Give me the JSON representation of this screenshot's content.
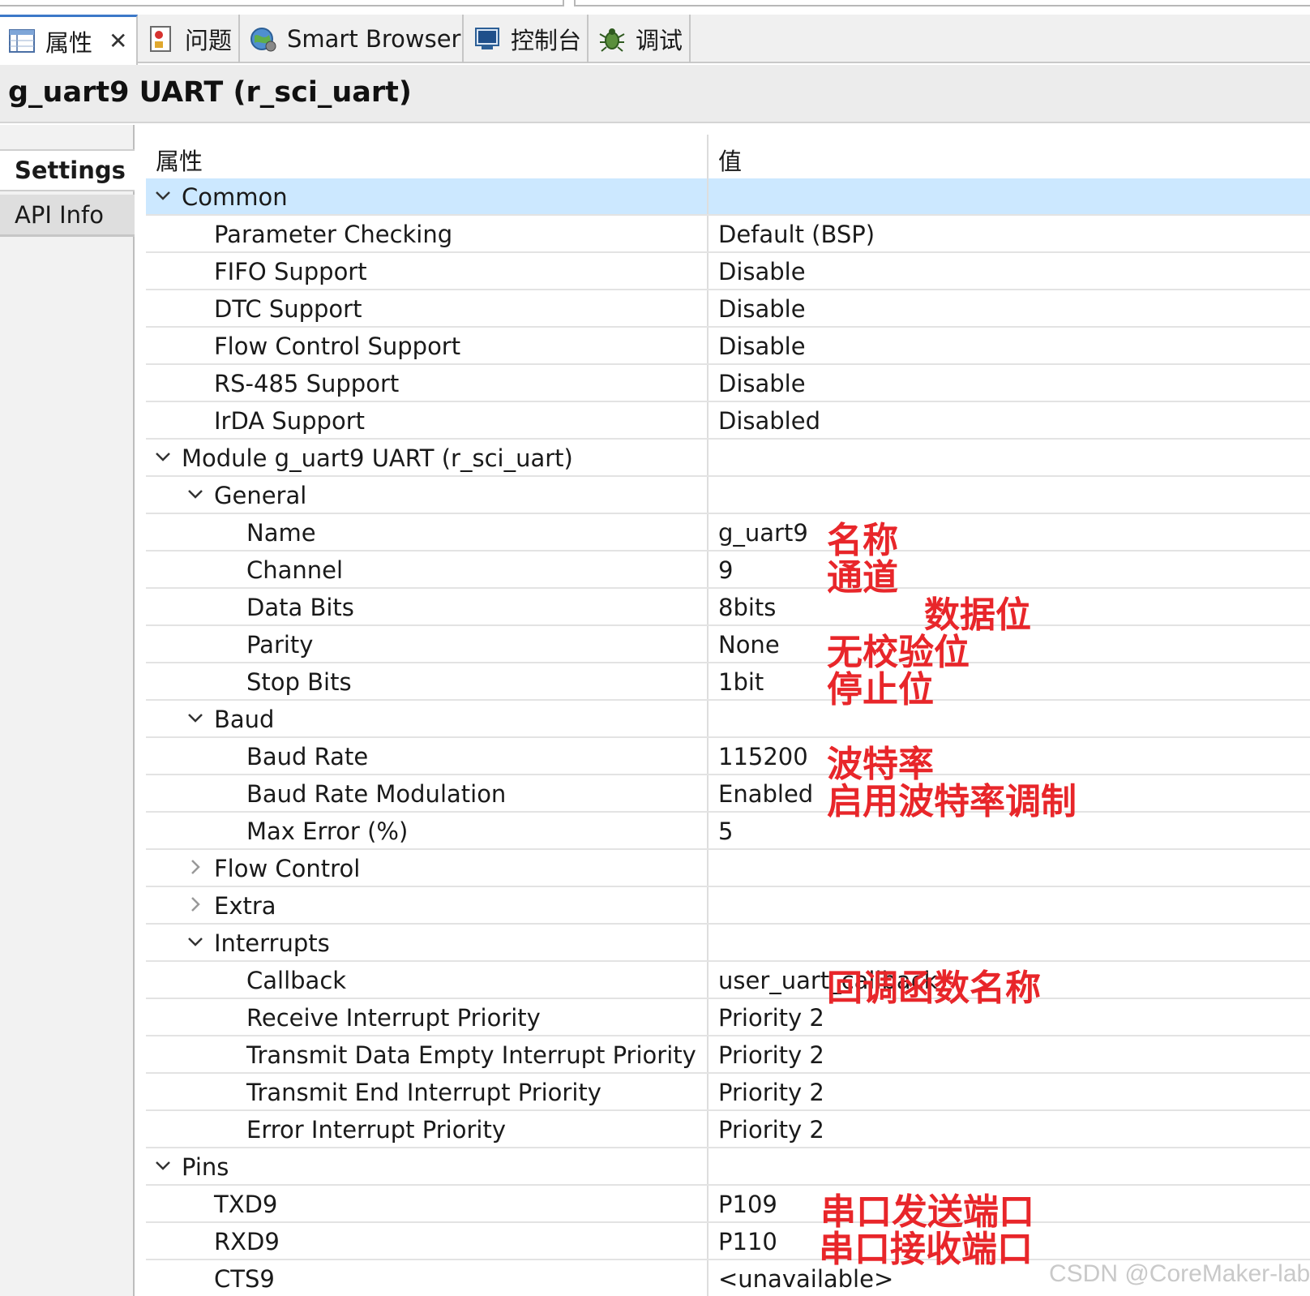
{
  "tabs": [
    {
      "label": "属性",
      "icon": "properties-icon",
      "active": true
    },
    {
      "label": "问题",
      "icon": "problems-icon"
    },
    {
      "label": "Smart Browser",
      "icon": "globe-icon"
    },
    {
      "label": "控制台",
      "icon": "console-icon"
    },
    {
      "label": "调试",
      "icon": "debug-bug-icon"
    }
  ],
  "close_glyph": "✕",
  "title": "g_uart9 UART (r_sci_uart)",
  "side_tabs": {
    "settings": "Settings",
    "api_info": "API Info"
  },
  "table": {
    "header_prop": "属性",
    "header_value": "值",
    "rows": [
      {
        "label": "Common",
        "value": "",
        "indent": 0,
        "toggle": "expanded",
        "selected": true
      },
      {
        "label": "Parameter Checking",
        "value": "Default (BSP)",
        "indent": 1
      },
      {
        "label": "FIFO Support",
        "value": "Disable",
        "indent": 1
      },
      {
        "label": "DTC Support",
        "value": "Disable",
        "indent": 1
      },
      {
        "label": "Flow Control Support",
        "value": "Disable",
        "indent": 1
      },
      {
        "label": "RS-485 Support",
        "value": "Disable",
        "indent": 1
      },
      {
        "label": "IrDA Support",
        "value": "Disabled",
        "indent": 1
      },
      {
        "label": "Module g_uart9 UART (r_sci_uart)",
        "value": "",
        "indent": 0,
        "toggle": "expanded"
      },
      {
        "label": "General",
        "value": "",
        "indent": 1,
        "toggle": "expanded"
      },
      {
        "label": "Name",
        "value": "g_uart9",
        "indent": 2,
        "note": "名称"
      },
      {
        "label": "Channel",
        "value": "9",
        "indent": 2,
        "note": "通道"
      },
      {
        "label": "Data Bits",
        "value": "8bits",
        "indent": 2,
        "note": "数据位"
      },
      {
        "label": "Parity",
        "value": "None",
        "indent": 2,
        "note": "无校验位"
      },
      {
        "label": "Stop Bits",
        "value": "1bit",
        "indent": 2,
        "note": "停止位"
      },
      {
        "label": "Baud",
        "value": "",
        "indent": 1,
        "toggle": "expanded"
      },
      {
        "label": "Baud Rate",
        "value": "115200",
        "indent": 2,
        "note": "波特率"
      },
      {
        "label": "Baud Rate Modulation",
        "value": "Enabled",
        "indent": 2,
        "note": "启用波特率调制"
      },
      {
        "label": "Max Error (%)",
        "value": "5",
        "indent": 2
      },
      {
        "label": "Flow Control",
        "value": "",
        "indent": 1,
        "toggle": "collapsed"
      },
      {
        "label": "Extra",
        "value": "",
        "indent": 1,
        "toggle": "collapsed"
      },
      {
        "label": "Interrupts",
        "value": "",
        "indent": 1,
        "toggle": "expanded"
      },
      {
        "label": "Callback",
        "value": "user_uart_callback",
        "indent": 2,
        "note": "回调函数名称"
      },
      {
        "label": "Receive Interrupt Priority",
        "value": "Priority 2",
        "indent": 2
      },
      {
        "label": "Transmit Data Empty Interrupt Priority",
        "value": "Priority 2",
        "indent": 2
      },
      {
        "label": "Transmit End Interrupt Priority",
        "value": "Priority 2",
        "indent": 2
      },
      {
        "label": "Error Interrupt Priority",
        "value": "Priority 2",
        "indent": 2
      },
      {
        "label": "Pins",
        "value": "",
        "indent": 0,
        "toggle": "expanded"
      },
      {
        "label": "TXD9",
        "value": "P109",
        "indent": 1,
        "note": "串口发送端口"
      },
      {
        "label": "RXD9",
        "value": "P110",
        "indent": 1,
        "note": "串口接收端口"
      },
      {
        "label": "CTS9",
        "value": "<unavailable>",
        "indent": 1
      }
    ]
  },
  "watermark": "CSDN @CoreMaker-lab",
  "colors": {
    "selection": "#cce8ff",
    "annotation": "#e8262a",
    "active_tab_accent": "#3c78c8"
  }
}
